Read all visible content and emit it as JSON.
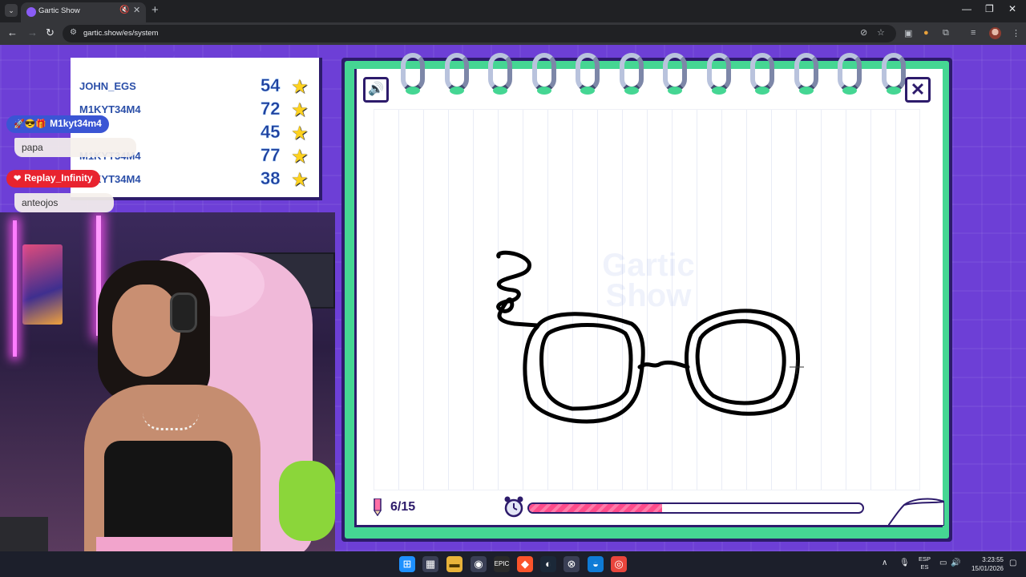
{
  "browser": {
    "tab_title": "Gartic Show",
    "url": "gartic.show/es/system",
    "new_tab": "+",
    "tab_close": "✕"
  },
  "scoreboard": {
    "rows": [
      {
        "name": "JOHN_EGS",
        "score": "54"
      },
      {
        "name": "M1KYT34M4",
        "score": "72"
      },
      {
        "name": "",
        "score": "45"
      },
      {
        "name": "M1KYT34M4",
        "score": "77"
      },
      {
        "name": "M1KYT34M4",
        "score": "38"
      }
    ]
  },
  "chat": {
    "messages": [
      {
        "user": "M1kyt34m4",
        "badges": "🚀😎🎁",
        "text": "papa",
        "color": "#3a55d4"
      },
      {
        "user": "Replay_Infinity",
        "badges": "❤",
        "text": "anteojos",
        "color": "#e8232f"
      }
    ]
  },
  "game": {
    "round": "6/15",
    "timer_remaining": 0.4,
    "watermark": "Gartic Show",
    "close_label": "✕",
    "sound_label": "🔊",
    "colors": {
      "frame": "#2d1b6b",
      "accent_green": "#45d693",
      "background": "#6d3fd6",
      "timer": "#ff4c8b"
    }
  },
  "taskbar": {
    "language": "ESP\nES",
    "time": "3:23:55",
    "date": "15/01/2026"
  }
}
